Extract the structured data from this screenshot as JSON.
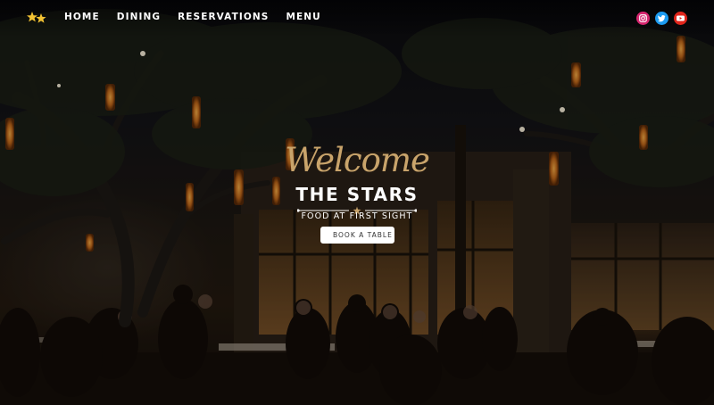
{
  "header": {
    "logo_icon": "stars-logo-icon",
    "nav": [
      {
        "label": "HOME"
      },
      {
        "label": "DINING"
      },
      {
        "label": "RESERVATIONS"
      },
      {
        "label": "MENU"
      }
    ],
    "social": [
      {
        "icon": "instagram-icon",
        "color": "#d6266f"
      },
      {
        "icon": "twitter-icon",
        "color": "#1d9bf0"
      },
      {
        "icon": "youtube-icon",
        "color": "#e1261c"
      }
    ]
  },
  "hero": {
    "script_heading": "Welcome",
    "title": "THE STARS",
    "tagline": "FOOD AT FIRST SIGHT",
    "cta_label": "BOOK A TABLE",
    "accent_color": "#c9a46b"
  }
}
